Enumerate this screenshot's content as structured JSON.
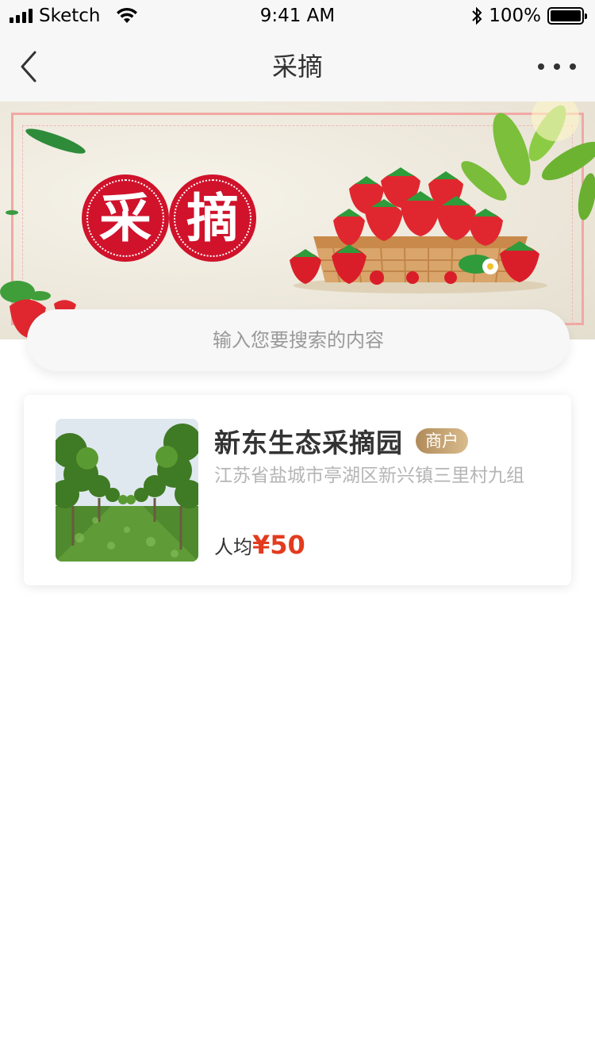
{
  "status_bar": {
    "carrier": "Sketch",
    "time": "9:41 AM",
    "battery_percent": "100%",
    "battery_level": 1.0,
    "icons": [
      "signal-icon",
      "wifi-icon",
      "bluetooth-icon",
      "battery-icon"
    ]
  },
  "nav": {
    "title": "采摘",
    "back_icon": "chevron-left-icon",
    "more_icon": "more-dots-icon"
  },
  "banner": {
    "badge_chars": [
      "采",
      "摘"
    ],
    "theme_color": "#d0122b"
  },
  "search": {
    "placeholder": "输入您要搜索的内容"
  },
  "listings": [
    {
      "name": "新东生态采摘园",
      "tag": "商户",
      "address": "江苏省盐城市亭湖区新兴镇三里村九组",
      "price_label": "人均",
      "price": "¥50"
    }
  ],
  "colors": {
    "price": "#e33b1e",
    "tag_gradient_start": "#b08a5a",
    "tag_gradient_end": "#d9bc8c",
    "background": "#ffffff",
    "bar_background": "#f7f7f7"
  }
}
